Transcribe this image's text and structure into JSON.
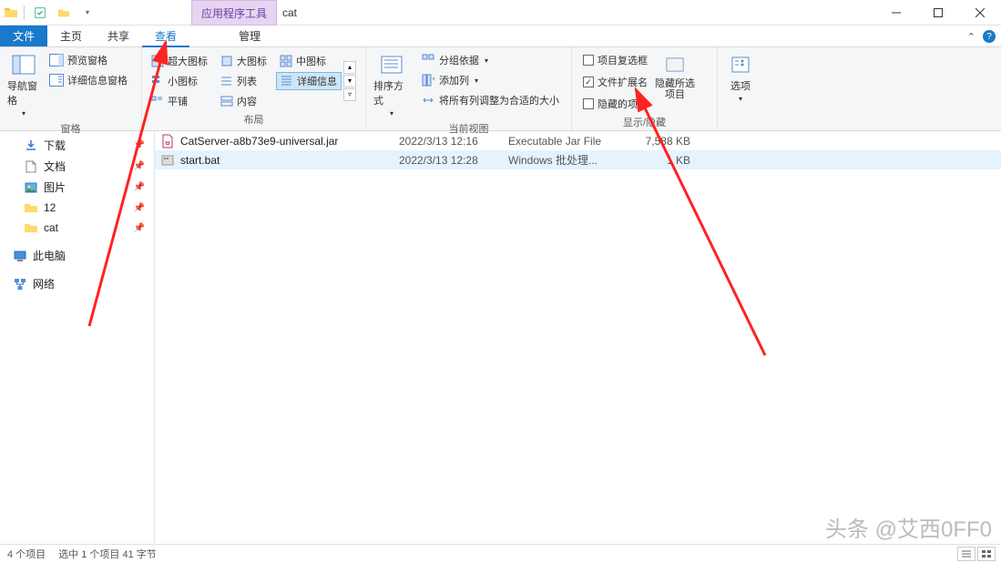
{
  "title": "cat",
  "contextual_tab": "应用程序工具",
  "tabs": {
    "file": "文件",
    "home": "主页",
    "share": "共享",
    "view": "查看",
    "manage": "管理"
  },
  "ribbon": {
    "panes_group": "窗格",
    "nav_pane": "导航窗格",
    "preview_pane": "预览窗格",
    "details_pane": "详细信息窗格",
    "layout_group": "布局",
    "xl_icons": "超大图标",
    "l_icons": "大图标",
    "m_icons": "中图标",
    "s_icons": "小图标",
    "list": "列表",
    "details": "详细信息",
    "tiles": "平铺",
    "content": "内容",
    "current_view_group": "当前视图",
    "sort_by": "排序方式",
    "group_by": "分组依据",
    "add_columns": "添加列",
    "fit_columns": "将所有列调整为合适的大小",
    "show_hide_group": "显示/隐藏",
    "item_checkboxes": "项目复选框",
    "file_ext": "文件扩展名",
    "hidden_items": "隐藏的项目",
    "hide_selected": "隐藏所选项目",
    "options": "选项"
  },
  "nav": {
    "downloads": "下载",
    "documents": "文档",
    "pictures": "图片",
    "folder12": "12",
    "foldercat": "cat",
    "this_pc": "此电脑",
    "network": "网络"
  },
  "files": [
    {
      "icon": "jar",
      "name": "CatServer-a8b73e9-universal.jar",
      "date": "2022/3/13 12:16",
      "type": "Executable Jar File",
      "size": "7,588 KB",
      "selected": false
    },
    {
      "icon": "bat",
      "name": "start.bat",
      "date": "2022/3/13 12:28",
      "type": "Windows 批处理...",
      "size": "1 KB",
      "selected": true
    }
  ],
  "status": {
    "count": "4 个项目",
    "selection": "选中 1 个项目 41 字节"
  },
  "watermark": "头条 @艾西0FF0"
}
